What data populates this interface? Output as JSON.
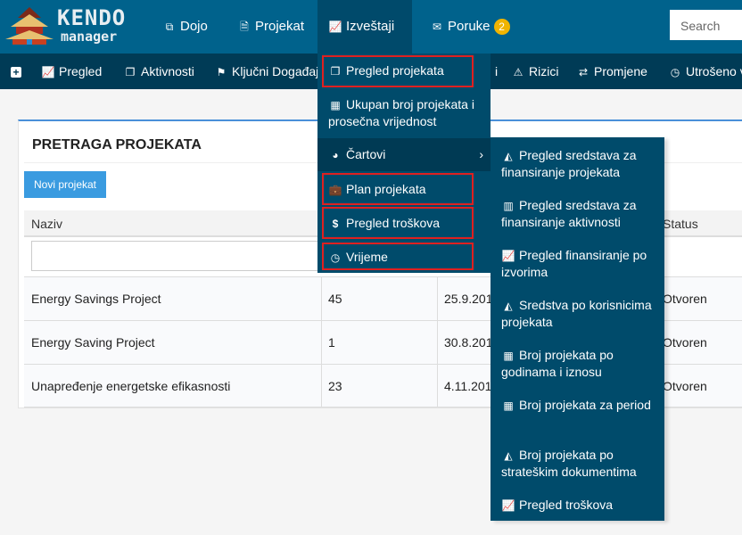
{
  "logo": {
    "line1": "KENDO",
    "line2": "manager"
  },
  "nav": [
    {
      "label": "Dojo",
      "icon": "copy-icon"
    },
    {
      "label": "Projekat",
      "icon": "document-icon"
    },
    {
      "label": "Izveštaji",
      "icon": "line-chart-icon"
    },
    {
      "label": "Poruke",
      "icon": "envelope-icon",
      "badge": "2"
    }
  ],
  "search": {
    "placeholder": "Search"
  },
  "subnav": [
    {
      "label": "",
      "icon": "plus-icon"
    },
    {
      "label": "Pregled",
      "icon": "line-chart-icon"
    },
    {
      "label": "Aktivnosti",
      "icon": "files-icon"
    },
    {
      "label": "Ključni Događaj",
      "icon": "flag-icon"
    },
    {
      "label": "i",
      "icon": ""
    },
    {
      "label": "Rizici",
      "icon": "warning-icon"
    },
    {
      "label": "Promjene",
      "icon": "exchange-icon"
    },
    {
      "label": "Utrošeno v",
      "icon": "clock-icon"
    }
  ],
  "panel": {
    "title": "PRETRAGA PROJEKATA",
    "new_button": "Novi projekat",
    "columns": [
      "Naziv",
      "Status"
    ],
    "rows": [
      [
        "Energy Savings Project",
        "45",
        "25.9.201",
        "Otvoren"
      ],
      [
        "Energy Saving Project",
        "1",
        "30.8.201",
        "Otvoren"
      ],
      [
        "Unapređenje energetske efikasnosti",
        "23",
        "4.11.201",
        "Otvoren"
      ]
    ]
  },
  "dropdown": [
    {
      "label": "Pregled projekata",
      "icon": "files-icon",
      "highlighted": true
    },
    {
      "label": "Ukupan broj projekata i prosečna vrijednost",
      "icon": "calculator-icon"
    },
    {
      "label": "Čartovi",
      "icon": "pie-chart-icon",
      "submenu": true
    },
    {
      "label": "Plan projekata",
      "icon": "briefcase-icon",
      "highlighted": true
    },
    {
      "label": "Pregled troškova",
      "icon": "dollar-icon",
      "highlighted": true
    },
    {
      "label": "Vrijeme",
      "icon": "clock-icon",
      "highlighted": true
    }
  ],
  "submenu": [
    {
      "label": "Pregled sredstava za finansiranje projekata",
      "icon": "area-chart-icon"
    },
    {
      "label": "Pregled sredstava za finansiranje aktivnosti",
      "icon": "bar-chart-icon"
    },
    {
      "label": "Pregled finansiranje po izvorima",
      "icon": "line-chart-icon"
    },
    {
      "label": "Sredstva po korisnicima projekata",
      "icon": "area-chart-icon"
    },
    {
      "label": "Broj projekata po godinama i iznosu",
      "icon": "calculator-icon"
    },
    {
      "label": "Broj projekata za period",
      "icon": "calendar-icon"
    },
    {
      "label": "Broj projekata po strateškim dokumentima",
      "icon": "area-chart-icon"
    },
    {
      "label": "Pregled troškova",
      "icon": "line-chart-icon"
    }
  ],
  "colors": {
    "topbar": "#00628c",
    "subbar": "#003b56",
    "menu": "#004b6b",
    "highlight": "#e02020",
    "button": "#3a9be0",
    "badge": "#f0b400"
  }
}
